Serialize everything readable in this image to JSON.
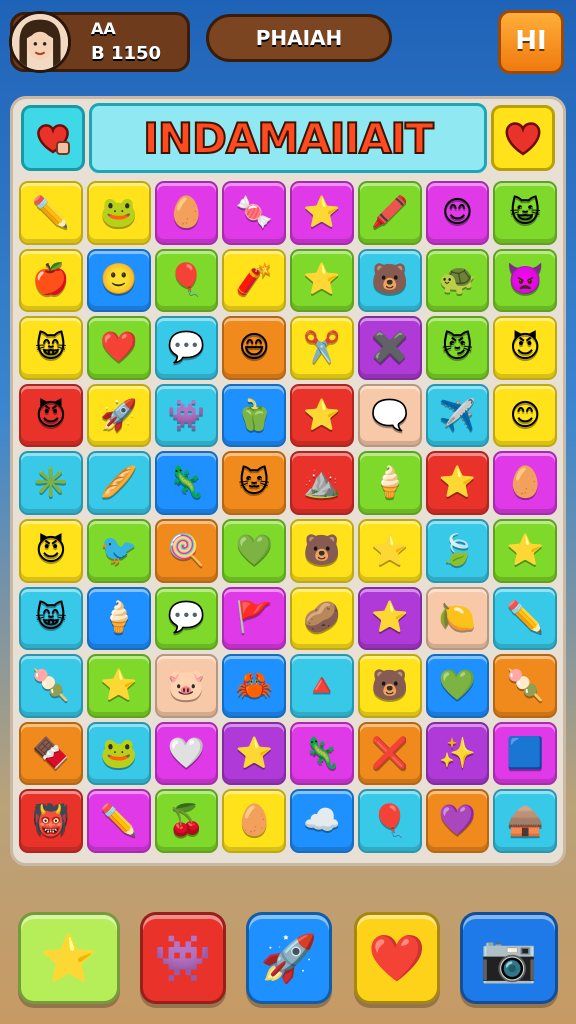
{
  "hud": {
    "player_name": "AA",
    "score": "B 1150",
    "title": "PHAIAH",
    "menu_label": "HI"
  },
  "board": {
    "title": "INDAMAIIAIT",
    "left_icon": "heart-pin-icon",
    "right_icon": "heart-icon",
    "tiles": [
      [
        {
          "c": "#ffe21a",
          "i": "✏️",
          "n": "pencil-icon"
        },
        {
          "c": "#ffe21a",
          "i": "🐸",
          "n": "blob-face-icon"
        },
        {
          "c": "#e03ae8",
          "i": "🥚",
          "n": "egg-icon"
        },
        {
          "c": "#e03ae8",
          "i": "🍬",
          "n": "candy-icon"
        },
        {
          "c": "#e03ae8",
          "i": "⭐",
          "n": "star-icon"
        },
        {
          "c": "#7fd92a",
          "i": "🖍️",
          "n": "crayon-icon"
        },
        {
          "c": "#e03ae8",
          "i": "😊",
          "n": "smiley-icon"
        },
        {
          "c": "#7fd92a",
          "i": "😺",
          "n": "cat-face-icon"
        }
      ],
      [
        {
          "c": "#ffe21a",
          "i": "🍎",
          "n": "apple-icon"
        },
        {
          "c": "#1e90ff",
          "i": "🙂",
          "n": "boy-face-icon"
        },
        {
          "c": "#7fd92a",
          "i": "🎈",
          "n": "balloon-icon"
        },
        {
          "c": "#ffe21a",
          "i": "🧨",
          "n": "rocket-icon"
        },
        {
          "c": "#7fd92a",
          "i": "⭐",
          "n": "star-icon"
        },
        {
          "c": "#39c9e8",
          "i": "🐻",
          "n": "bear-face-icon"
        },
        {
          "c": "#7fd92a",
          "i": "🐢",
          "n": "turtle-icon"
        },
        {
          "c": "#7fd92a",
          "i": "👿",
          "n": "devil-face-icon"
        }
      ],
      [
        {
          "c": "#ffe21a",
          "i": "😸",
          "n": "cat-face-icon"
        },
        {
          "c": "#7fd92a",
          "i": "❤️",
          "n": "heart-icon"
        },
        {
          "c": "#39c9e8",
          "i": "💬",
          "n": "speech-bubble-icon"
        },
        {
          "c": "#f08a1c",
          "i": "😄",
          "n": "smiley-icon"
        },
        {
          "c": "#ffe21a",
          "i": "✂️",
          "n": "scissors-icon"
        },
        {
          "c": "#b03ad8",
          "i": "✖️",
          "n": "cross-icon"
        },
        {
          "c": "#7fd92a",
          "i": "😼",
          "n": "cat-face-icon"
        },
        {
          "c": "#ffe21a",
          "i": "😈",
          "n": "devil-face-icon"
        }
      ],
      [
        {
          "c": "#e8322a",
          "i": "😈",
          "n": "devil-face-icon"
        },
        {
          "c": "#ffe21a",
          "i": "🚀",
          "n": "rocket-icon"
        },
        {
          "c": "#39c9e8",
          "i": "👾",
          "n": "monster-face-icon"
        },
        {
          "c": "#1e90ff",
          "i": "🫑",
          "n": "pepper-icon"
        },
        {
          "c": "#e8322a",
          "i": "⭐",
          "n": "star-icon"
        },
        {
          "c": "#f7c9a8",
          "i": "🗨️",
          "n": "speech-bubble-icon"
        },
        {
          "c": "#39c9e8",
          "i": "✈️",
          "n": "plane-icon"
        },
        {
          "c": "#ffe21a",
          "i": "😊",
          "n": "smiley-icon"
        }
      ],
      [
        {
          "c": "#39c9e8",
          "i": "✳️",
          "n": "star-shape-icon"
        },
        {
          "c": "#39c9e8",
          "i": "🥖",
          "n": "bread-icon"
        },
        {
          "c": "#1e90ff",
          "i": "🦎",
          "n": "lizard-icon"
        },
        {
          "c": "#f08a1c",
          "i": "🐱",
          "n": "cat-face-icon"
        },
        {
          "c": "#e8322a",
          "i": "⛰️",
          "n": "mountain-icon"
        },
        {
          "c": "#7fd92a",
          "i": "🍦",
          "n": "ice-cream-icon"
        },
        {
          "c": "#e8322a",
          "i": "⭐",
          "n": "star-icon"
        },
        {
          "c": "#e03ae8",
          "i": "🥚",
          "n": "egg-icon"
        }
      ],
      [
        {
          "c": "#ffe21a",
          "i": "😈",
          "n": "devil-face-icon"
        },
        {
          "c": "#7fd92a",
          "i": "🐦",
          "n": "bird-icon"
        },
        {
          "c": "#f08a1c",
          "i": "🍭",
          "n": "popsicle-icon"
        },
        {
          "c": "#7fd92a",
          "i": "💚",
          "n": "heart-icon"
        },
        {
          "c": "#ffe21a",
          "i": "🐻",
          "n": "bear-face-icon"
        },
        {
          "c": "#ffe21a",
          "i": "⭐",
          "n": "star-icon"
        },
        {
          "c": "#39c9e8",
          "i": "🍃",
          "n": "leaf-icon"
        },
        {
          "c": "#7fd92a",
          "i": "⭐",
          "n": "star-icon"
        }
      ],
      [
        {
          "c": "#39c9e8",
          "i": "😸",
          "n": "cat-face-icon"
        },
        {
          "c": "#1e90ff",
          "i": "🍦",
          "n": "ice-cream-icon"
        },
        {
          "c": "#7fd92a",
          "i": "💬",
          "n": "speech-bubble-icon"
        },
        {
          "c": "#e03ae8",
          "i": "🚩",
          "n": "flag-icon"
        },
        {
          "c": "#ffe21a",
          "i": "🥔",
          "n": "potato-icon"
        },
        {
          "c": "#b03ad8",
          "i": "⭐",
          "n": "star-icon"
        },
        {
          "c": "#f7c9a8",
          "i": "🍋",
          "n": "lemon-icon"
        },
        {
          "c": "#39c9e8",
          "i": "✏️",
          "n": "pencil-icon"
        }
      ],
      [
        {
          "c": "#39c9e8",
          "i": "🍡",
          "n": "popsicle-icon"
        },
        {
          "c": "#7fd92a",
          "i": "⭐",
          "n": "star-icon"
        },
        {
          "c": "#f7c9a8",
          "i": "🐷",
          "n": "pig-face-icon"
        },
        {
          "c": "#1e90ff",
          "i": "🦀",
          "n": "crab-icon"
        },
        {
          "c": "#39c9e8",
          "i": "🔺",
          "n": "triangle-icon"
        },
        {
          "c": "#ffe21a",
          "i": "🐻",
          "n": "bear-face-icon"
        },
        {
          "c": "#1e90ff",
          "i": "💚",
          "n": "heart-icon"
        },
        {
          "c": "#f08a1c",
          "i": "🍡",
          "n": "popsicle-icon"
        }
      ],
      [
        {
          "c": "#f08a1c",
          "i": "🍫",
          "n": "chocolate-icon"
        },
        {
          "c": "#39c9e8",
          "i": "🐸",
          "n": "frog-icon"
        },
        {
          "c": "#e03ae8",
          "i": "🤍",
          "n": "heart-icon"
        },
        {
          "c": "#b03ad8",
          "i": "⭐",
          "n": "star-icon"
        },
        {
          "c": "#e03ae8",
          "i": "🦎",
          "n": "lizard-icon"
        },
        {
          "c": "#f08a1c",
          "i": "❌",
          "n": "cross-icon"
        },
        {
          "c": "#b03ad8",
          "i": "✨",
          "n": "sparkle-icon"
        },
        {
          "c": "#e03ae8",
          "i": "🟦",
          "n": "block-icon"
        }
      ],
      [
        {
          "c": "#e8322a",
          "i": "👹",
          "n": "monster-face-icon"
        },
        {
          "c": "#e03ae8",
          "i": "✏️",
          "n": "pencil-icon"
        },
        {
          "c": "#7fd92a",
          "i": "🍒",
          "n": "cherry-icon"
        },
        {
          "c": "#ffe21a",
          "i": "🥚",
          "n": "egg-icon"
        },
        {
          "c": "#1e90ff",
          "i": "☁️",
          "n": "cloud-icon"
        },
        {
          "c": "#39c9e8",
          "i": "🎈",
          "n": "balloon-icon"
        },
        {
          "c": "#f08a1c",
          "i": "💜",
          "n": "heart-icon"
        },
        {
          "c": "#39c9e8",
          "i": "🛖",
          "n": "hut-icon"
        }
      ]
    ]
  },
  "bottom_buttons": [
    {
      "name": "star-booster-button",
      "icon": "⭐",
      "color": "#b6ee5a"
    },
    {
      "name": "monster-booster-button",
      "icon": "👾",
      "color": "#e8322a"
    },
    {
      "name": "rocket-booster-button",
      "icon": "🚀",
      "color": "#1e90ff"
    },
    {
      "name": "heart-booster-button",
      "icon": "❤️",
      "color": "#ffd21a"
    },
    {
      "name": "camera-button",
      "icon": "📷",
      "color": "#1e7ae8"
    }
  ]
}
